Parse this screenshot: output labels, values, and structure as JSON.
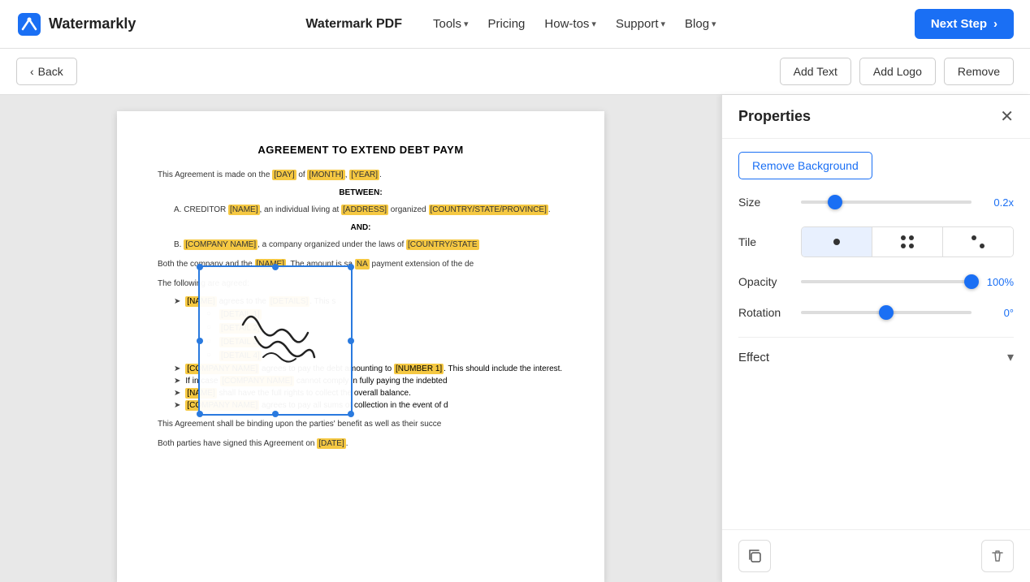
{
  "header": {
    "logo_text": "Watermarkly",
    "nav_brand": "Watermark PDF",
    "nav_items": [
      {
        "label": "Tools",
        "has_dropdown": true
      },
      {
        "label": "Pricing",
        "has_dropdown": false
      },
      {
        "label": "How-tos",
        "has_dropdown": true
      },
      {
        "label": "Support",
        "has_dropdown": true
      },
      {
        "label": "Blog",
        "has_dropdown": true
      }
    ],
    "next_step_label": "Next Step"
  },
  "toolbar": {
    "back_label": "Back",
    "add_text_label": "Add Text",
    "add_logo_label": "Add Logo",
    "remove_label": "Remove"
  },
  "document": {
    "title": "AGREEMENT TO EXTEND DEBT PAYM",
    "intro": "This Agreement is made on the",
    "day_placeholder": "[DAY]",
    "of_text": "of",
    "month_placeholder": "[MONTH]",
    "year_placeholder": "[YEAR]",
    "between": "BETWEEN:",
    "creditor_text": "A. CREDITOR",
    "creditor_name": "[NAME]",
    "creditor_living": ", an individual living at",
    "creditor_address": "[ADDRESS]",
    "creditor_organized": "organized",
    "creditor_country": "[COUNTRY/STATE/PROVINCE]",
    "and_text": "AND:",
    "company_b": "B.",
    "company_name": "[COMPANY NAME]",
    "company_laws": ", a company organized under the laws of",
    "company_country": "[COUNTRY/STATE",
    "body_text1": "Both the company and the",
    "name_ref1": "[NAME]",
    "amount_said": ". The amount is sa",
    "name_ref2": "NA",
    "payment_text": "payment extension of the de",
    "agreed_text": "The following are agreed:",
    "bullet1_name": "[NAME]",
    "bullet1_agrees": "agrees to the",
    "bullet1_details": "[DETAILS]",
    "detail1": "[DETAIL 1]",
    "detail2": "[DETAIL 2]",
    "detail3": "[DETAIL 3]",
    "detail4": "[DETAIL 4]",
    "bullet2_company": "[COMPANY NAME]",
    "bullet2_debt": "agrees to pay the debt amounting to",
    "bullet2_number": "[NUMBER 1]",
    "bullet2_interest": ". This should include the interest.",
    "bullet3_ifcase": "If in case",
    "bullet3_company2": "[COMPANY NAME]",
    "bullet3_cannot": "cannot comply in fully paying the indebted",
    "bullet4_name2": "[NAME]",
    "bullet4_rights": "shall have the full rights to collect the overall balance.",
    "bullet5_company3": "[COMPANY NAME]",
    "bullet5_collection": "agrees to pay all sums of collection in the event of d",
    "binding_text": "This Agreement shall be binding upon the parties' benefit as well as their succe",
    "signed_text": "Both parties have signed this Agreement on",
    "signed_date": "[DATE]"
  },
  "properties_panel": {
    "title": "Properties",
    "remove_bg_label": "Remove Background",
    "size_label": "Size",
    "size_value": "0.2x",
    "size_percent": 20,
    "tile_label": "Tile",
    "tile_options": [
      "single",
      "four",
      "diagonal"
    ],
    "tile_active": 0,
    "opacity_label": "Opacity",
    "opacity_value": "100%",
    "opacity_percent": 100,
    "rotation_label": "Rotation",
    "rotation_value": "0°",
    "rotation_percent": 50,
    "effect_label": "Effect",
    "copy_icon": "copy",
    "delete_icon": "trash"
  },
  "colors": {
    "accent_blue": "#1a6ff4",
    "highlight_yellow": "#f5c842"
  }
}
